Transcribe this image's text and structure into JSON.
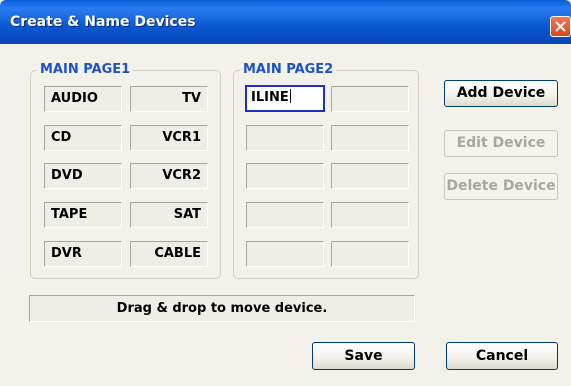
{
  "window": {
    "title": "Create & Name Devices"
  },
  "page1": {
    "label": "MAIN PAGE1",
    "rows": [
      [
        "AUDIO",
        "TV"
      ],
      [
        "CD",
        "VCR1"
      ],
      [
        "DVD",
        "VCR2"
      ],
      [
        "TAPE",
        "SAT"
      ],
      [
        "DVR",
        "CABLE"
      ]
    ]
  },
  "page2": {
    "label": "MAIN PAGE2",
    "rows": [
      [
        "ILINE",
        ""
      ],
      [
        "",
        ""
      ],
      [
        "",
        ""
      ],
      [
        "",
        ""
      ],
      [
        "",
        ""
      ]
    ]
  },
  "buttons": {
    "add": "Add Device",
    "edit": "Edit Device",
    "delete": "Delete Device",
    "save": "Save",
    "cancel": "Cancel"
  },
  "status": "Drag & drop to move device.",
  "icons": {
    "close": "close-icon"
  }
}
